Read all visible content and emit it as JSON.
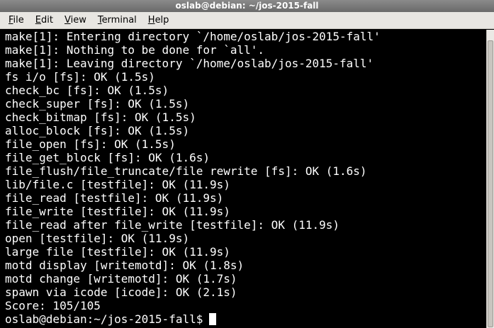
{
  "window": {
    "title": "oslab@debian: ~/jos-2015-fall"
  },
  "menu": [
    {
      "mnemonic": "F",
      "rest": "ile"
    },
    {
      "mnemonic": "E",
      "rest": "dit"
    },
    {
      "mnemonic": "V",
      "rest": "iew"
    },
    {
      "mnemonic": "T",
      "rest": "erminal"
    },
    {
      "mnemonic": "H",
      "rest": "elp"
    }
  ],
  "terminal": {
    "lines": [
      "make[1]: Entering directory `/home/oslab/jos-2015-fall'",
      "make[1]: Nothing to be done for `all'.",
      "make[1]: Leaving directory `/home/oslab/jos-2015-fall'",
      "fs i/o [fs]: OK (1.5s)",
      "check_bc [fs]: OK (1.5s)",
      "check_super [fs]: OK (1.5s)",
      "check_bitmap [fs]: OK (1.5s)",
      "alloc_block [fs]: OK (1.5s)",
      "file_open [fs]: OK (1.5s)",
      "file_get_block [fs]: OK (1.6s)",
      "file_flush/file_truncate/file rewrite [fs]: OK (1.6s)",
      "lib/file.c [testfile]: OK (11.9s)",
      "file_read [testfile]: OK (11.9s)",
      "file_write [testfile]: OK (11.9s)",
      "file_read after file_write [testfile]: OK (11.9s)",
      "open [testfile]: OK (11.9s)",
      "large file [testfile]: OK (11.9s)",
      "motd display [writemotd]: OK (1.8s)",
      "motd change [writemotd]: OK (1.7s)",
      "spawn via icode [icode]: OK (2.1s)",
      "Score: 105/105"
    ],
    "prompt": "oslab@debian:~/jos-2015-fall$"
  }
}
